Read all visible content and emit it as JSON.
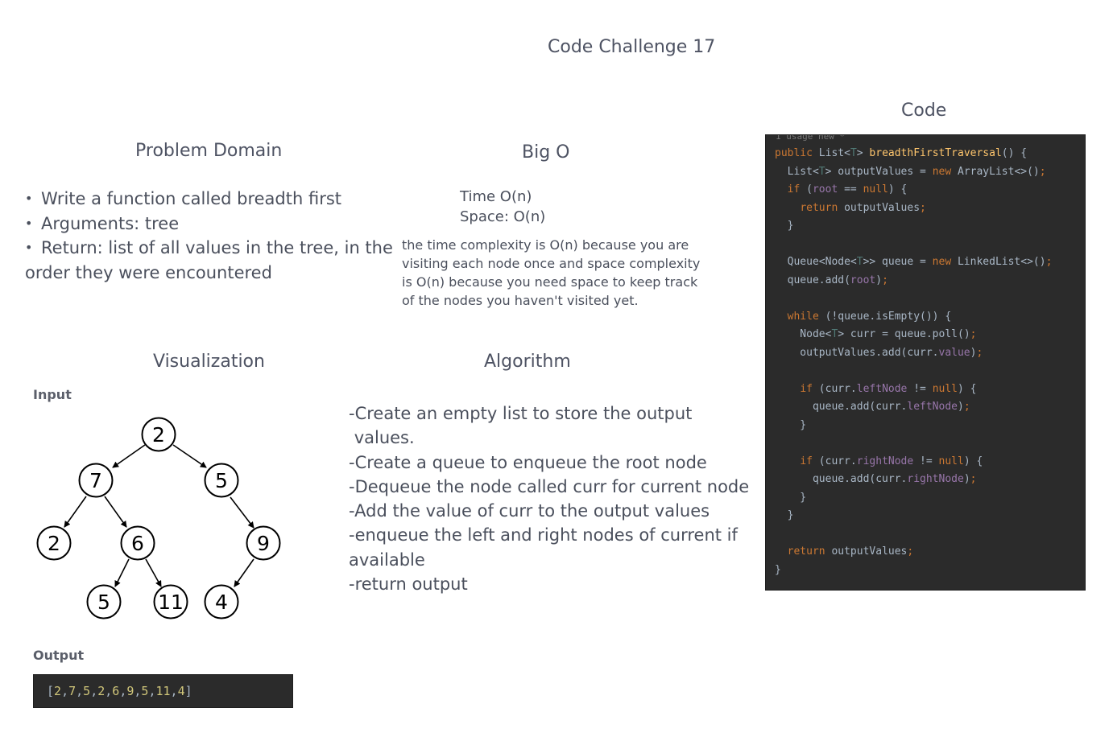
{
  "title": "Code Challenge 17",
  "problem_domain": {
    "heading": "Problem Domain",
    "bullets": [
      "Write a function called breadth first",
      "Arguments: tree",
      "Return: list of all values in the tree, in the"
    ],
    "continuation": "order they were encountered"
  },
  "big_o": {
    "heading": "Big O",
    "time": "Time O(n)",
    "space": "Space: O(n)",
    "explanation": "the time complexity is O(n) because you are visiting each node once and space complexity is O(n) because you need space to keep track of the nodes you haven't visited yet."
  },
  "visualization": {
    "heading": "Visualization",
    "input_label": "Input",
    "output_label": "Output",
    "tree_nodes": [
      "2",
      "7",
      "5",
      "2",
      "6",
      "9",
      "5",
      "11",
      "4"
    ],
    "output_values": [
      "2",
      "7",
      "5",
      "2",
      "6",
      "9",
      "5",
      "11",
      "4"
    ]
  },
  "algorithm": {
    "heading": "Algorithm",
    "steps": [
      "-Create an empty list to store the output",
      " values.",
      "-Create a queue to enqueue the root node",
      "-Dequeue the node called curr for current node",
      "-Add the value of curr to the output values",
      "-enqueue the left and right nodes of current if",
      "available",
      "-return output"
    ]
  },
  "code": {
    "heading": "Code",
    "usage_hint": "1 usage  new *",
    "lines": [
      "public List<T> breadthFirstTraversal() {",
      "  List<T> outputValues = new ArrayList<>();",
      "  if (root == null) {",
      "    return outputValues;",
      "  }",
      "",
      "  Queue<Node<T>> queue = new LinkedList<>();",
      "  queue.add(root);",
      "",
      "  while (!queue.isEmpty()) {",
      "    Node<T> curr = queue.poll();",
      "    outputValues.add(curr.value);",
      "",
      "    if (curr.leftNode != null) {",
      "      queue.add(curr.leftNode);",
      "    }",
      "",
      "    if (curr.rightNode != null) {",
      "      queue.add(curr.rightNode);",
      "    }",
      "  }",
      "",
      "  return outputValues;",
      "}"
    ]
  }
}
